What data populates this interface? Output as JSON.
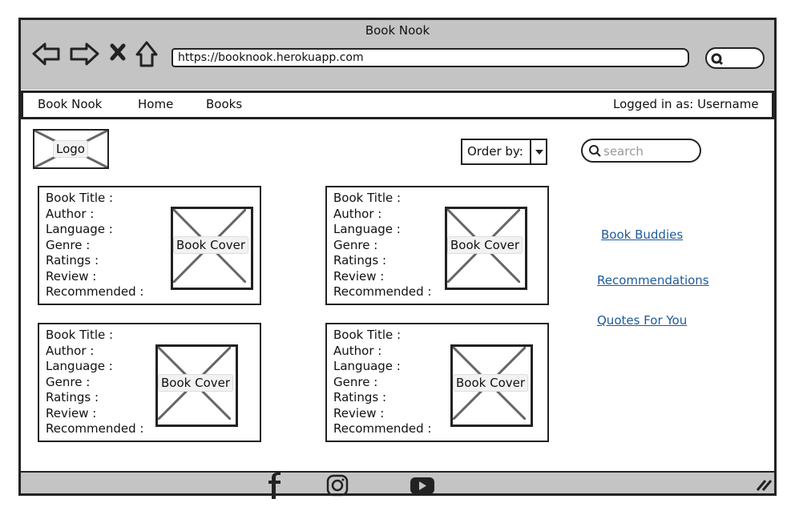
{
  "browser": {
    "title": "Book Nook",
    "url": "https://booknook.herokuapp.com"
  },
  "nav": {
    "brand": "Book Nook",
    "home": "Home",
    "books": "Books",
    "user": "Logged in as: Username"
  },
  "logo": {
    "label": "Logo"
  },
  "order_by": {
    "label": "Order by:"
  },
  "search": {
    "placeholder": "search"
  },
  "cards": [
    {
      "fields": [
        "Book Title :",
        "Author :",
        "Language :",
        "Genre :",
        "Ratings :",
        "Review :",
        "Recommended :"
      ],
      "cover_label": "Book Cover"
    },
    {
      "fields": [
        "Book Title :",
        "Author :",
        "Language :",
        "Genre :",
        "Ratings :",
        "Review :",
        "Recommended :"
      ],
      "cover_label": "Book Cover"
    },
    {
      "fields": [
        "Book Title :",
        "Author :",
        "Language :",
        "Genre :",
        "Ratings :",
        "Review :",
        "Recommended :"
      ],
      "cover_label": "Book Cover"
    },
    {
      "fields": [
        "Book Title :",
        "Author :",
        "Language :",
        "Genre :",
        "Ratings :",
        "Review :",
        "Recommended :"
      ],
      "cover_label": "Book Cover"
    }
  ],
  "sidebar": {
    "links": [
      "Book Buddies",
      "Recommendations",
      "Quotes For You"
    ]
  },
  "footer": {
    "icons": [
      "facebook-icon",
      "instagram-icon",
      "youtube-icon"
    ]
  }
}
